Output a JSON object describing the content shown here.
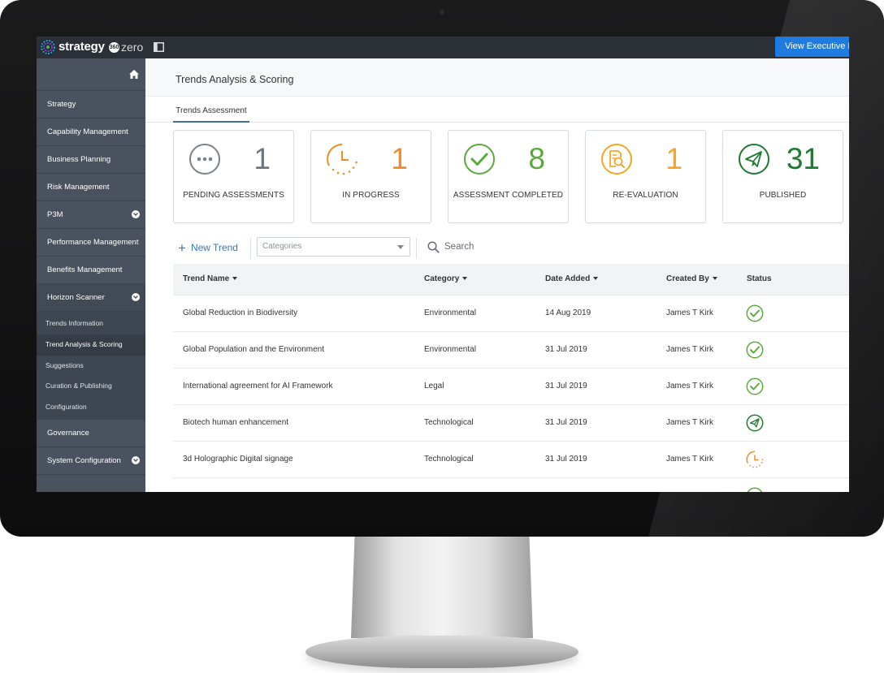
{
  "colors": {
    "pending": "#7a828c",
    "in_progress": "#f08c2a",
    "completed": "#5aab3c",
    "re_evaluation": "#f5a623",
    "published": "#1f7a30",
    "accent": "#1e7be0",
    "sidebar": "#49525e"
  },
  "topbar": {
    "logo_text": "strategy",
    "logo_badge": "360",
    "logo_suffix": "zero",
    "exec_button": "View Executive Da"
  },
  "sidebar": {
    "items": [
      {
        "label": "Strategy"
      },
      {
        "label": "Capability Management"
      },
      {
        "label": "Business Planning"
      },
      {
        "label": "Risk Management"
      },
      {
        "label": "P3M"
      },
      {
        "label": "Performance Management"
      },
      {
        "label": "Benefits Management"
      },
      {
        "label": "Horizon Scanner"
      }
    ],
    "sub_items": [
      {
        "label": "Trends Information"
      },
      {
        "label": "Trend Analysis & Scoring"
      },
      {
        "label": "Suggestions"
      },
      {
        "label": "Curation & Publishing"
      },
      {
        "label": "Configuration"
      }
    ],
    "bottom_items": [
      {
        "label": "Governance"
      },
      {
        "label": "System Configuration"
      }
    ]
  },
  "page": {
    "title": "Trends Analysis & Scoring",
    "tab": "Trends Assessment"
  },
  "cards": [
    {
      "label": "PENDING ASSESSMENTS",
      "count": "1",
      "icon": "ellipsis-circle-icon"
    },
    {
      "label": "IN PROGRESS",
      "count": "1",
      "icon": "clock-progress-icon"
    },
    {
      "label": "ASSESSMENT COMPLETED",
      "count": "8",
      "icon": "check-circle-icon"
    },
    {
      "label": "RE-EVALUATION",
      "count": "1",
      "icon": "document-search-icon"
    },
    {
      "label": "PUBLISHED",
      "count": "31",
      "icon": "paper-plane-icon"
    }
  ],
  "toolbar": {
    "new_trend": "New Trend",
    "category_placeholder": "Categories",
    "search_placeholder": "Search"
  },
  "table": {
    "headers": [
      "Trend Name",
      "Category",
      "Date Added",
      "Created By",
      "Status"
    ],
    "rows": [
      {
        "name": "Global Reduction in Biodiversity",
        "category": "Environmental",
        "date": "14 Aug 2019",
        "created_by": "James T Kirk",
        "status": "completed"
      },
      {
        "name": "Global Population and the Environment",
        "category": "Environmental",
        "date": "31 Jul 2019",
        "created_by": "James T Kirk",
        "status": "completed"
      },
      {
        "name": "International agreement for AI Framework",
        "category": "Legal",
        "date": "31 Jul 2019",
        "created_by": "James T Kirk",
        "status": "completed"
      },
      {
        "name": "Biotech human enhancement",
        "category": "Technological",
        "date": "31 Jul 2019",
        "created_by": "James T Kirk",
        "status": "published"
      },
      {
        "name": "3d Holographic Digital signage",
        "category": "Technological",
        "date": "31 Jul 2019",
        "created_by": "James T Kirk",
        "status": "in_progress"
      }
    ]
  }
}
